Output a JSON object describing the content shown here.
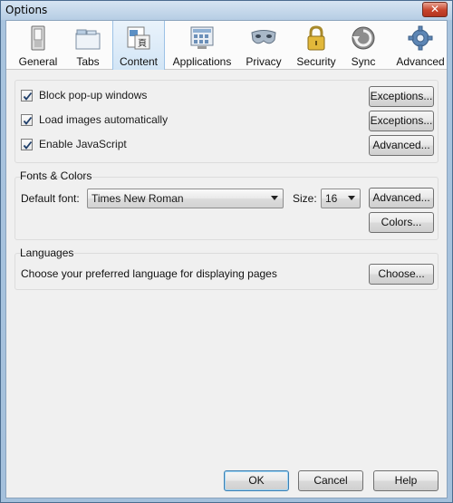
{
  "window": {
    "title": "Options",
    "close_glyph": "✕"
  },
  "toolbar": {
    "panes": [
      {
        "label": "General",
        "icon": "general-switch-icon",
        "selected": false
      },
      {
        "label": "Tabs",
        "icon": "tabs-icon",
        "selected": false
      },
      {
        "label": "Content",
        "icon": "content-page-icon",
        "selected": true
      },
      {
        "label": "Applications",
        "icon": "applications-icon",
        "selected": false
      },
      {
        "label": "Privacy",
        "icon": "privacy-mask-icon",
        "selected": false
      },
      {
        "label": "Security",
        "icon": "padlock-icon",
        "selected": false
      },
      {
        "label": "Sync",
        "icon": "sync-icon",
        "selected": false
      },
      {
        "label": "Advanced",
        "icon": "gear-icon",
        "selected": false
      }
    ]
  },
  "content": {
    "options": [
      {
        "label": "Block pop-up windows",
        "checked": true,
        "button": "Exceptions..."
      },
      {
        "label": "Load images automatically",
        "checked": true,
        "button": "Exceptions..."
      },
      {
        "label": "Enable JavaScript",
        "checked": true,
        "button": "Advanced..."
      }
    ],
    "fonts": {
      "caption": "Fonts & Colors",
      "default_font_label": "Default font:",
      "default_font_value": "Times New Roman",
      "size_label": "Size:",
      "size_value": "16",
      "advanced_button": "Advanced...",
      "colors_button": "Colors..."
    },
    "languages": {
      "caption": "Languages",
      "description": "Choose your preferred language for displaying pages",
      "choose_button": "Choose..."
    }
  },
  "footer": {
    "ok": "OK",
    "cancel": "Cancel",
    "help": "Help"
  },
  "colors": {
    "selected_tab": "#d2e5f6",
    "accent_border": "#3c7fb1"
  }
}
